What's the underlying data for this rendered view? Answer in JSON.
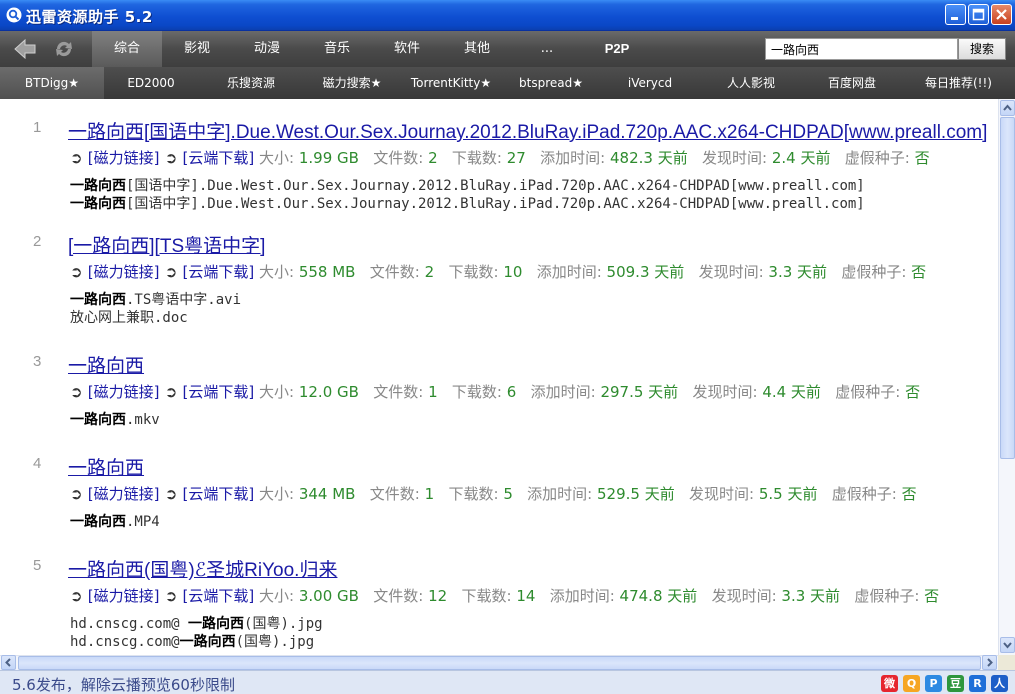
{
  "window": {
    "title": "迅雷资源助手 5.2"
  },
  "categories": [
    {
      "label": "综合",
      "active": true
    },
    {
      "label": "影视"
    },
    {
      "label": "动漫"
    },
    {
      "label": "音乐"
    },
    {
      "label": "软件"
    },
    {
      "label": "其他"
    },
    {
      "label": "..."
    },
    {
      "label": "P2P"
    }
  ],
  "search": {
    "value": "一路向西",
    "button_label": "搜索"
  },
  "sites": [
    {
      "label": "BTDigg★",
      "active": true
    },
    {
      "label": "ED2000"
    },
    {
      "label": "乐搜资源"
    },
    {
      "label": "磁力搜索★"
    },
    {
      "label": "TorrentKitty★"
    },
    {
      "label": "btspread★"
    },
    {
      "label": "iVerycd"
    },
    {
      "label": "人人影视"
    },
    {
      "label": "百度网盘"
    },
    {
      "label": "每日推荐(!!)"
    }
  ],
  "meta_labels": {
    "arrow": "➲",
    "magnet": "[磁力链接]",
    "cloud": "[云端下载]",
    "size": "大小:",
    "files": "文件数:",
    "downloads": "下载数:",
    "added": "添加时间:",
    "found": "发现时间:",
    "fake": "虚假种子:"
  },
  "results": [
    {
      "num": "1",
      "title": "一路向西[国语中字].Due.West.Our.Sex.Journay.2012.BluRay.iPad.720p.AAC.x264-CHDPAD[www.preall.com]",
      "size": "1.99 GB",
      "files": "2",
      "downloads": "27",
      "added": "482.3 天前",
      "found": "2.4 天前",
      "fake": "否",
      "file_lines": [
        {
          "bold": "一路向西",
          "rest": "[国语中字].Due.West.Our.Sex.Journay.2012.BluRay.iPad.720p.AAC.x264-CHDPAD[www.preall.com]"
        },
        {
          "bold": "一路向西",
          "rest": "[国语中字].Due.West.Our.Sex.Journay.2012.BluRay.iPad.720p.AAC.x264-CHDPAD[www.preall.com]"
        }
      ]
    },
    {
      "num": "2",
      "title": "[一路向西][TS粤语中字]",
      "size": "558 MB",
      "files": "2",
      "downloads": "10",
      "added": "509.3 天前",
      "found": "3.3 天前",
      "fake": "否",
      "file_lines": [
        {
          "bold": "一路向西",
          "rest": ".TS粤语中字.avi"
        },
        {
          "pre": "放心网上兼职.doc",
          "bold": "",
          "rest": ""
        }
      ]
    },
    {
      "num": "3",
      "title": "一路向西",
      "size": "12.0 GB",
      "files": "1",
      "downloads": "6",
      "added": "297.5 天前",
      "found": "4.4 天前",
      "fake": "否",
      "file_lines": [
        {
          "bold": "一路向西",
          "rest": ".mkv"
        }
      ]
    },
    {
      "num": "4",
      "title": "一路向西",
      "size": "344 MB",
      "files": "1",
      "downloads": "5",
      "added": "529.5 天前",
      "found": "5.5 天前",
      "fake": "否",
      "file_lines": [
        {
          "bold": "一路向西",
          "rest": ".MP4"
        }
      ]
    },
    {
      "num": "5",
      "title": "一路向西(国粤)ℰ圣城RiYoo.归来",
      "size": "3.00 GB",
      "files": "12",
      "downloads": "14",
      "added": "474.8 天前",
      "found": "3.3 天前",
      "fake": "否",
      "file_lines": [
        {
          "pre": "hd.cnscg.com@ ",
          "bold": "一路向西",
          "rest": "(国粤).jpg"
        },
        {
          "pre": "hd.cnscg.com@",
          "bold": "一路向西",
          "rest": "(国粤).jpg"
        }
      ]
    }
  ],
  "status": {
    "text": "5.6发布，解除云播预览60秒限制"
  },
  "share_icons": [
    {
      "icon": "weibo-icon",
      "glyph": "微",
      "color": "#e6262e"
    },
    {
      "icon": "qzone-icon",
      "glyph": "Q",
      "color": "#f6a623"
    },
    {
      "icon": "pengyou-icon",
      "glyph": "P",
      "color": "#2d8ae2"
    },
    {
      "icon": "douban-icon",
      "glyph": "豆",
      "color": "#2e963d"
    },
    {
      "icon": "renren-share-icon",
      "glyph": "R",
      "color": "#1f6fd8"
    },
    {
      "icon": "renren-icon",
      "glyph": "人",
      "color": "#1c5ec8"
    }
  ]
}
